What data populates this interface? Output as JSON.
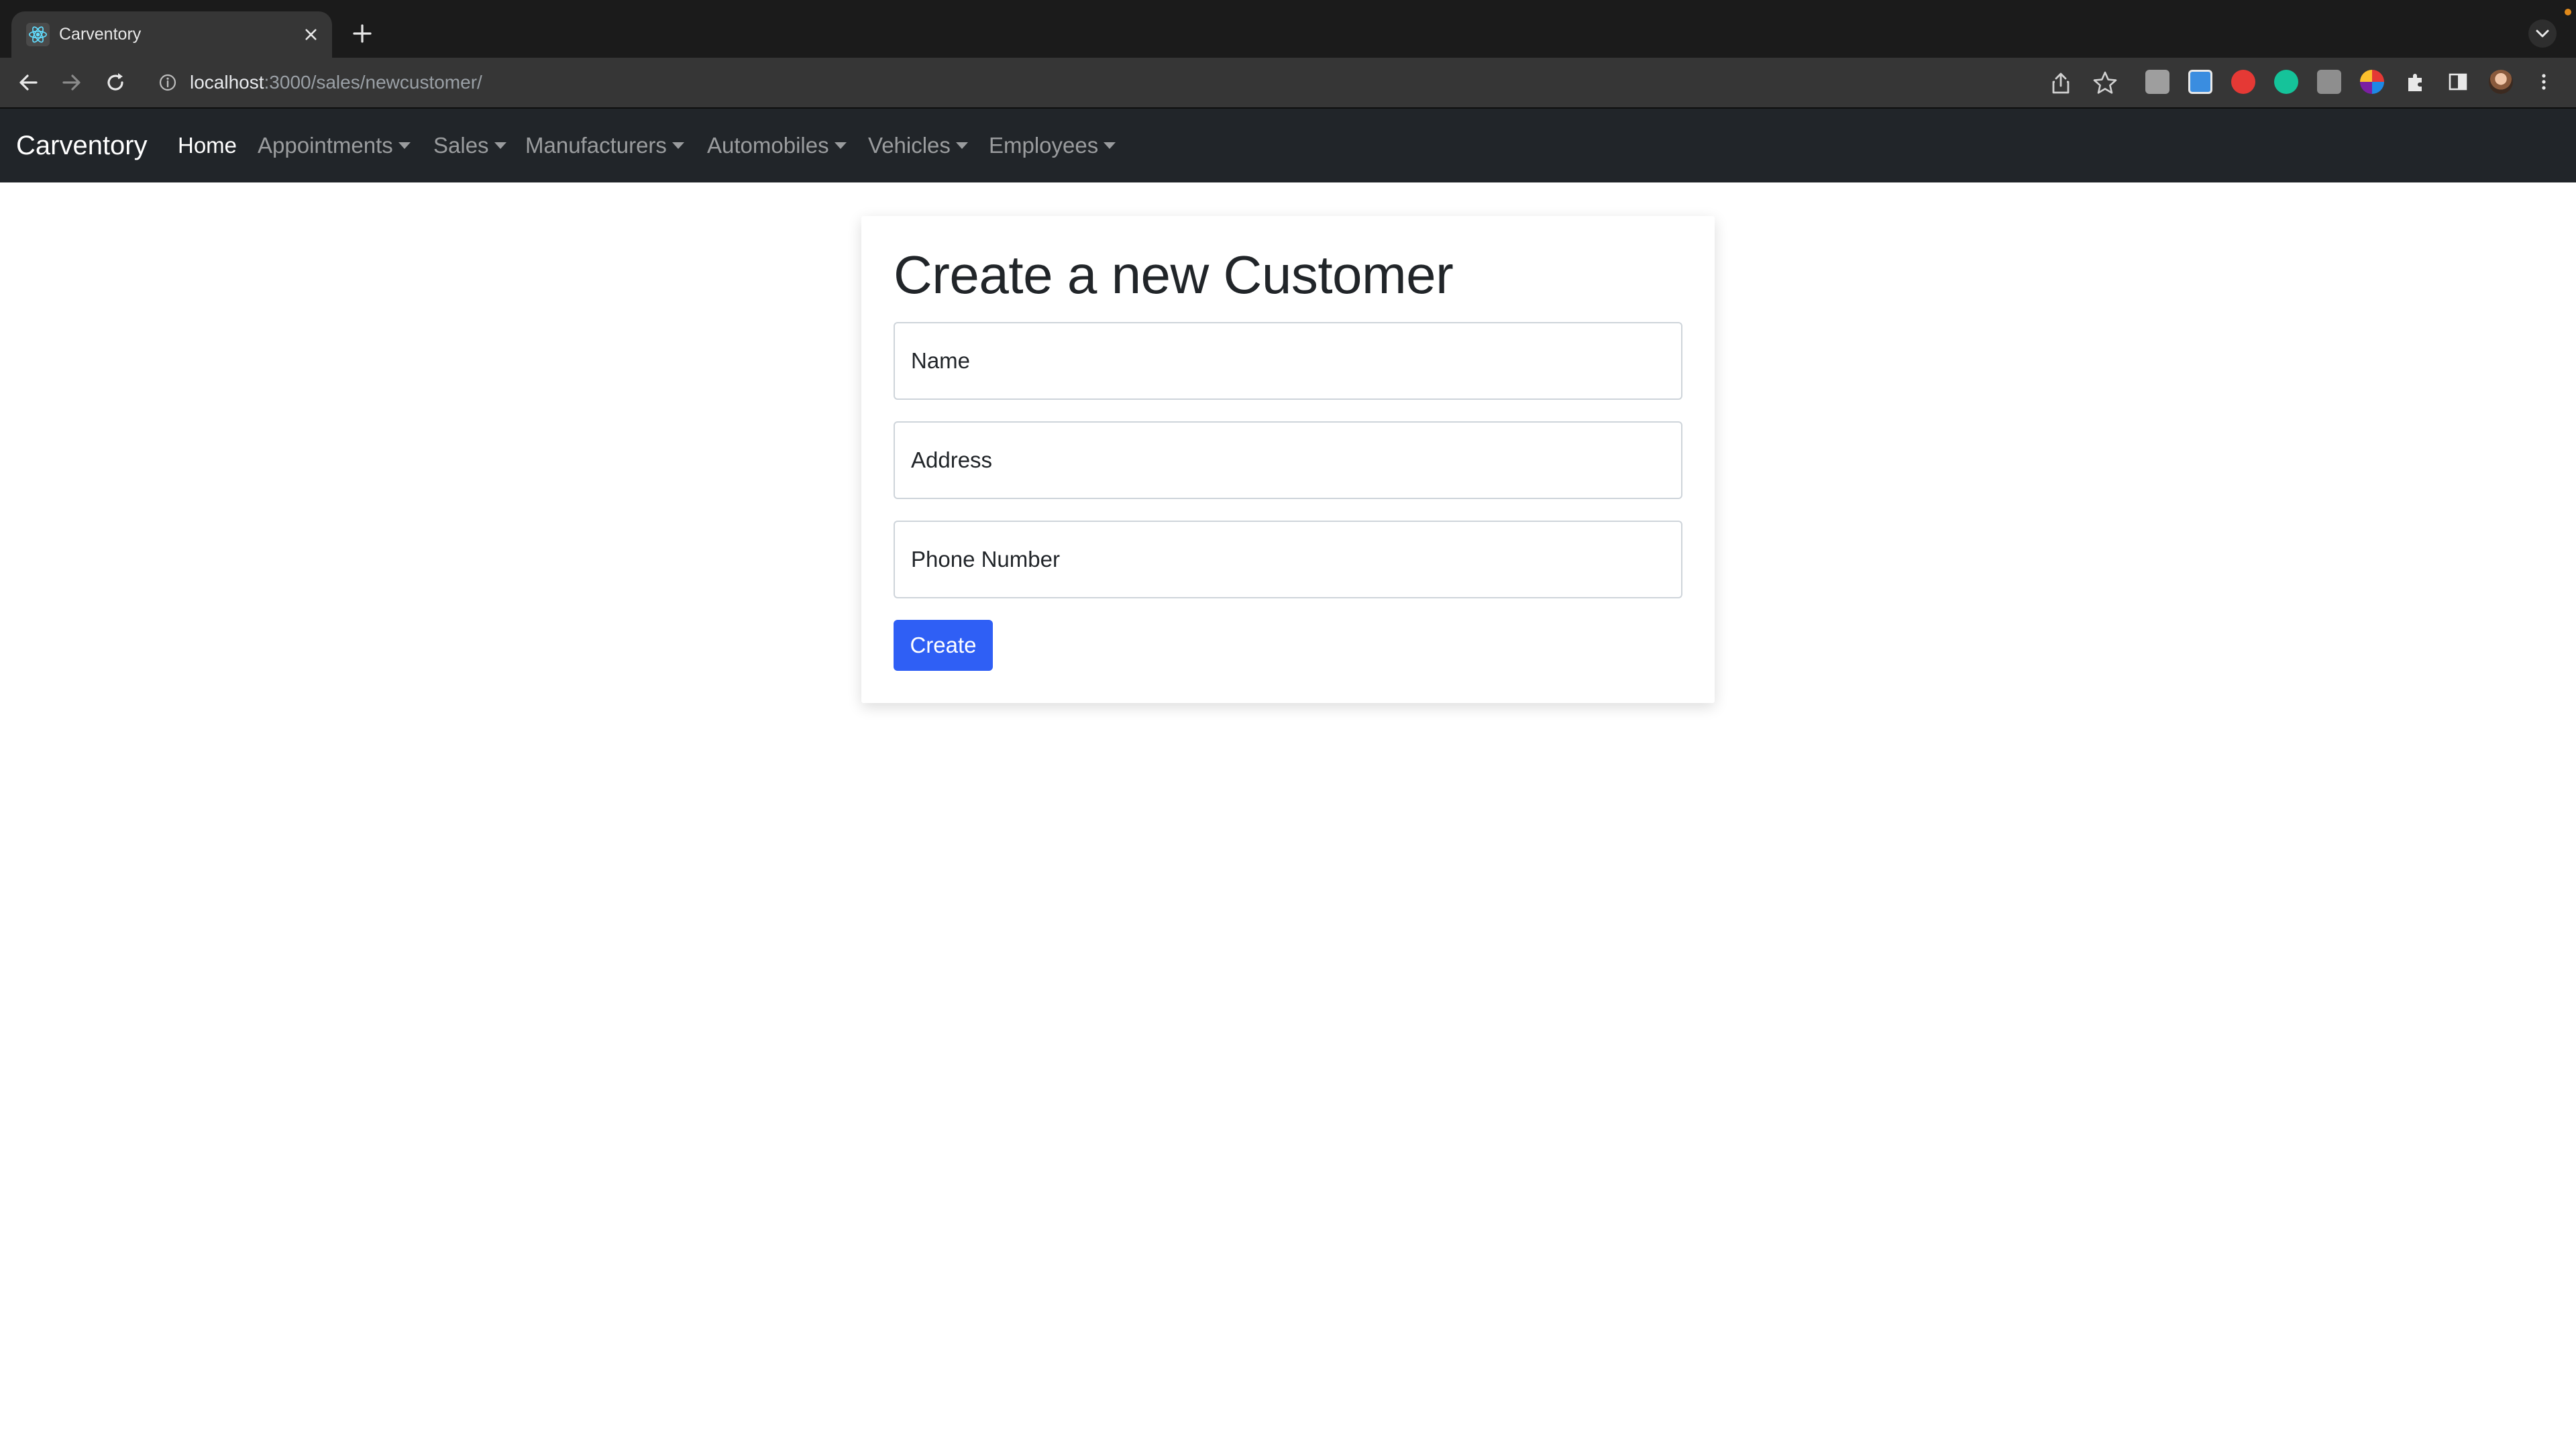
{
  "browser": {
    "tab_title": "Carventory",
    "url_host": "localhost",
    "url_path": ":3000/sales/newcustomer/",
    "icons": [
      "react-favicon-icon",
      "close-icon",
      "plus-icon",
      "back-icon",
      "forward-icon",
      "reload-icon",
      "info-icon",
      "share-icon",
      "star-icon",
      "extensions-icon",
      "side-panel-icon",
      "profile-avatar",
      "kebab-menu-icon"
    ]
  },
  "navbar": {
    "brand": "Carventory",
    "links": [
      {
        "label": "Home",
        "dropdown": false,
        "active": true
      },
      {
        "label": "Appointments",
        "dropdown": true
      },
      {
        "label": "Sales",
        "dropdown": true
      },
      {
        "label": "Manufacturers",
        "dropdown": true
      },
      {
        "label": "Automobiles",
        "dropdown": true
      },
      {
        "label": "Vehicles",
        "dropdown": true
      },
      {
        "label": "Employees",
        "dropdown": true
      }
    ]
  },
  "form": {
    "title": "Create a new Customer",
    "fields": [
      {
        "placeholder": "Name",
        "value": ""
      },
      {
        "placeholder": "Address",
        "value": ""
      },
      {
        "placeholder": "Phone Number",
        "value": ""
      }
    ],
    "submit_label": "Create"
  },
  "colors": {
    "navbar_bg": "#212529",
    "primary_button": "#2f5ff5",
    "chrome_bg": "#363636"
  }
}
